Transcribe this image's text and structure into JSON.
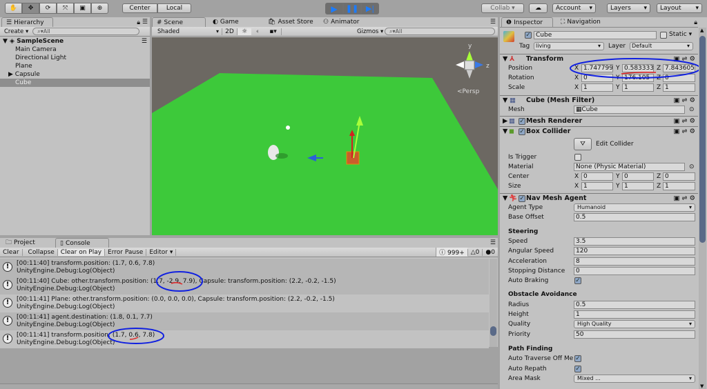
{
  "toolbar": {
    "tools": [
      "hand-tool",
      "move-tool",
      "rotate-tool",
      "scale-tool",
      "rect-tool",
      "transform-tool"
    ],
    "pivot": "Center",
    "space": "Local",
    "collab": "Collab",
    "account": "Account",
    "layers": "Layers",
    "layout": "Layout"
  },
  "hierarchy": {
    "tab": "Hierarchy",
    "create": "Create",
    "search_placeholder": "All",
    "scene": "SampleScene",
    "items": [
      "Main Camera",
      "Directional Light",
      "Plane",
      "Capsule",
      "Cube"
    ]
  },
  "scene": {
    "tabs": [
      "Scene",
      "Game",
      "Asset Store",
      "Animator"
    ],
    "shading": "Shaded",
    "mode2d": "2D",
    "gizmos": "Gizmos",
    "search_placeholder": "All",
    "persp": "Persp",
    "axis_y": "y",
    "axis_z": "z"
  },
  "console": {
    "tabs": [
      "Project",
      "Console"
    ],
    "buttons": [
      "Clear",
      "Collapse",
      "Clear on Play",
      "Error Pause",
      "Editor"
    ],
    "counts": {
      "log": "999+",
      "warn": "0",
      "error": "0"
    },
    "logs": [
      {
        "line1": "[00:11:40] transform.position: (1.7, 0.6, 7.8)",
        "line2": "UnityEngine.Debug:Log(Object)"
      },
      {
        "line1": "[00:11:40] Cube: other.transform.position: (1.7, -2.9, 7.9), Capsule: transform.position: (2.2, -0.2, -1.5)",
        "line2": "UnityEngine.Debug:Log(Object)"
      },
      {
        "line1": "[00:11:41] Plane: other.transform.position: (0.0, 0.0, 0.0), Capsule: transform.position: (2.2, -0.2, -1.5)",
        "line2": "UnityEngine.Debug:Log(Object)"
      },
      {
        "line1": "[00:11:41] agent.destination: (1.8, 0.1, 7.7)",
        "line2": "UnityEngine.Debug:Log(Object)"
      },
      {
        "line1": "[00:11:41] transform.position: (1.7, 0.6, 7.8)",
        "line2": "UnityEngine.Debug:Log(Object)"
      }
    ]
  },
  "inspector": {
    "tabs": [
      "Inspector",
      "Navigation"
    ],
    "name": "Cube",
    "static": "Static",
    "tag_label": "Tag",
    "tag": "living",
    "layer_label": "Layer",
    "layer": "Default",
    "transform": {
      "title": "Transform",
      "position_label": "Position",
      "position": [
        "1.747799",
        "0.583333",
        "7.843605"
      ],
      "rotation_label": "Rotation",
      "rotation": [
        "0",
        "176.105",
        "0"
      ],
      "scale_label": "Scale",
      "scale": [
        "1",
        "1",
        "1"
      ],
      "axes": [
        "X",
        "Y",
        "Z"
      ]
    },
    "mesh_filter": {
      "title": "Cube (Mesh Filter)",
      "mesh_label": "Mesh",
      "mesh": "Cube"
    },
    "mesh_renderer": {
      "title": "Mesh Renderer"
    },
    "box_collider": {
      "title": "Box Collider",
      "edit": "Edit Collider",
      "is_trigger": "Is Trigger",
      "material_label": "Material",
      "material": "None (Physic Material)",
      "center_label": "Center",
      "center": [
        "0",
        "0",
        "0"
      ],
      "size_label": "Size",
      "size": [
        "1",
        "1",
        "1"
      ]
    },
    "nav_agent": {
      "title": "Nav Mesh Agent",
      "agent_type_label": "Agent Type",
      "agent_type": "Humanoid",
      "base_offset_label": "Base Offset",
      "base_offset": "0.5",
      "steering": "Steering",
      "speed_label": "Speed",
      "speed": "3.5",
      "angular_label": "Angular Speed",
      "angular": "120",
      "accel_label": "Acceleration",
      "accel": "8",
      "stop_label": "Stopping Distance",
      "stop": "0",
      "braking_label": "Auto Braking",
      "obstacle": "Obstacle Avoidance",
      "radius_label": "Radius",
      "radius": "0.5",
      "height_label": "Height",
      "height": "1",
      "quality_label": "Quality",
      "quality": "High Quality",
      "priority_label": "Priority",
      "priority": "50",
      "path": "Path Finding",
      "traverse_label": "Auto Traverse Off Me",
      "repath_label": "Auto Repath",
      "area_label": "Area Mask",
      "area": "Mixed ..."
    }
  }
}
